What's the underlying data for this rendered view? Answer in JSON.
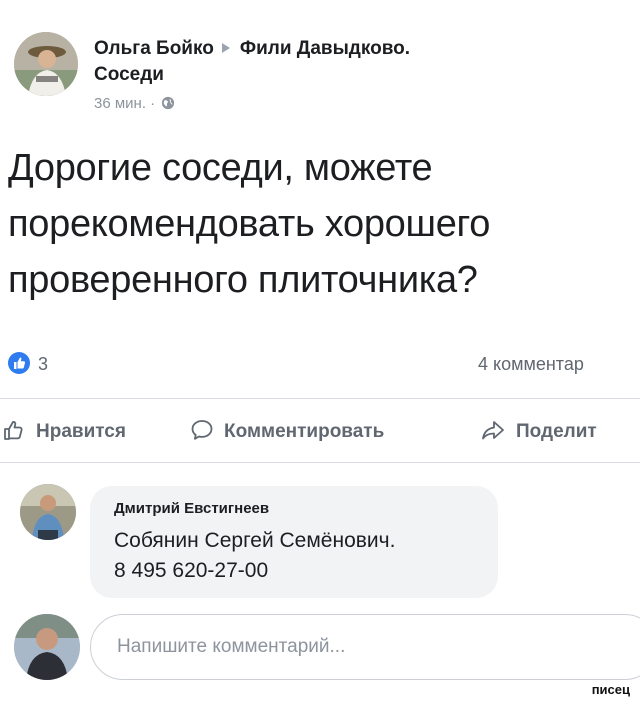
{
  "post": {
    "author": "Ольга Бойко",
    "group_line1": "Фили Давыдково.",
    "group_line2": "Соседи",
    "time": "36 мин.",
    "meta_separator": "·",
    "body_lines": [
      "Дорогие соседи, можете",
      "порекомендовать хорошего",
      "проверенного плиточника?"
    ],
    "like_count": "3",
    "comment_count": "4 комментар"
  },
  "actions": {
    "like": "Нравится",
    "comment": "Комментировать",
    "share": "Поделит"
  },
  "comment": {
    "author": "Дмитрий Евстигнеев",
    "lines": [
      "Собянин Сергей Семёнович.",
      "8 495 620-27-00"
    ]
  },
  "composer": {
    "placeholder": "Напишите комментарий..."
  },
  "watermark": "писец",
  "icons": {
    "author_avatar": "avatar-icon",
    "arrow": "arrow-right-icon",
    "globe": "globe-icon",
    "like_badge": "thumbs-up-icon",
    "like_action": "thumbs-up-outline-icon",
    "comment_action": "speech-bubble-icon",
    "share_action": "share-arrow-icon"
  },
  "colors": {
    "accent": "#2f7bf0",
    "secondary_text": "#606770",
    "meta_text": "#8d949e",
    "bubble_bg": "#f2f3f5",
    "divider": "#dadde1"
  }
}
